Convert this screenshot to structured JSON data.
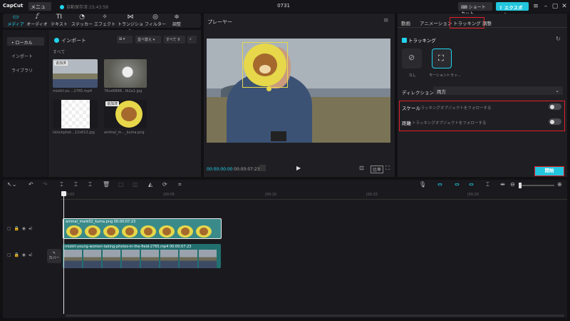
{
  "app": {
    "logo": "CapCut",
    "menu": "メニュー",
    "autosave": "自動保存済:15:43:59",
    "project_title": "0731",
    "shortcut": "ショートカット",
    "export": "エクスポート"
  },
  "toolbar": {
    "tabs": [
      {
        "label": "メディア",
        "icon": "▭"
      },
      {
        "label": "オーディオ",
        "icon": "♪"
      },
      {
        "label": "テキスト",
        "icon": "TI"
      },
      {
        "label": "ステッカー",
        "icon": "◔"
      },
      {
        "label": "エフェクト",
        "icon": "✧"
      },
      {
        "label": "トランジション",
        "icon": "⋈"
      },
      {
        "label": "フィルター",
        "icon": "◎"
      },
      {
        "label": "調整",
        "icon": "≑"
      }
    ]
  },
  "sidebar": {
    "items": [
      {
        "label": "• ローカル"
      },
      {
        "label": "インポート"
      },
      {
        "label": "ライブラリ"
      }
    ]
  },
  "media": {
    "import": "インポート",
    "sort": "並べ替え",
    "filter": "すべて",
    "section": "すべて",
    "files": [
      {
        "name": "mixkit-yo....2765.mp4",
        "badge": "追加済"
      },
      {
        "name": "76ce6898...fb2a1.jpg",
        "badge": ""
      },
      {
        "name": "istockphot...12x612.jpg",
        "badge": ""
      },
      {
        "name": "animal_m..._kuma.png",
        "badge": "追加済"
      }
    ]
  },
  "player": {
    "title": "プレーヤー",
    "current": "00:00:00:00",
    "total": "00:00:07:23"
  },
  "inspector": {
    "tabs": [
      {
        "label": "動画"
      },
      {
        "label": "アニメーション"
      },
      {
        "label": "トラッキング"
      },
      {
        "label": "調整"
      }
    ],
    "tracking_label": "トラッキング",
    "option_none": "なし",
    "option_motion": "モーショントラッ...",
    "direction_label": "ディレクション",
    "direction_value": "両方",
    "scale_label": "スケール",
    "scale_desc": "トラッキングオブジェクトをフォローする",
    "distance_label": "距離",
    "distance_desc": "トラッキングオブジェクトをフォローする",
    "start": "開始"
  },
  "timeline": {
    "ruler": [
      "00:00",
      "|00:05",
      "|00:10",
      "|00:15",
      "|00:20"
    ],
    "cover": "カバー",
    "clip1_label": "animal_mark02_kuma.png  00:00:07:23",
    "clip2_label": "mixkit-young-women-taking-photos-in-the-field-2765.mp4  00:00:07:23"
  },
  "colors": {
    "accent": "#22d3ee",
    "highlight": "#e11d2a",
    "bear_yellow": "#e6d84a",
    "bear_brown": "#a5692e"
  }
}
